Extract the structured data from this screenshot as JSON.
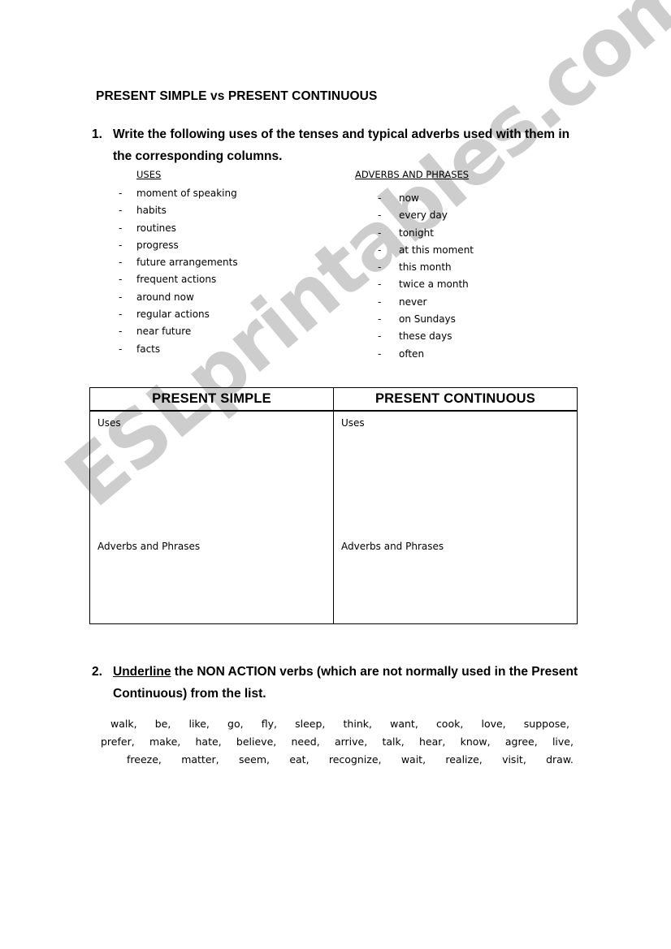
{
  "document": {
    "title": "PRESENT SIMPLE vs PRESENT CONTINUOUS"
  },
  "questions": [
    {
      "number": "1.",
      "text_part1": "Write the following uses of the tenses and typical adverbs used with them in the corresponding columns."
    },
    {
      "number": "2.",
      "underlined": "Underline",
      "text_rest": " the NON ACTION verbs (which are not normally used in the Present Continuous) from the list."
    }
  ],
  "uses_column": {
    "heading": "USES",
    "dash": "-",
    "items": [
      "moment of speaking",
      "habits",
      "routines",
      "progress",
      "future arrangements",
      "frequent actions",
      "around now",
      "regular actions",
      "near future",
      "facts"
    ]
  },
  "adverbs_column": {
    "heading": "ADVERBS AND PHRASES",
    "dash": "-",
    "items": [
      "now",
      "every day",
      "tonight",
      "at this moment",
      "this month",
      "twice a month",
      "never",
      "on Sundays",
      "these days",
      "often"
    ]
  },
  "tense_table": {
    "headers": [
      "PRESENT SIMPLE",
      "PRESENT CONTINUOUS"
    ],
    "row_labels": [
      "Uses",
      "Adverbs and Phrases"
    ],
    "cells": [
      {
        "uses": "Uses",
        "adverbs": "Adverbs and Phrases"
      },
      {
        "uses": "Uses",
        "adverbs": "Adverbs and Phrases"
      }
    ]
  },
  "verb_list": {
    "lines": [
      [
        "walk,",
        "be,",
        "like,",
        "go,",
        "fly,",
        "sleep,",
        "think,",
        "want,",
        "cook,",
        "love,",
        "suppose,"
      ],
      [
        "prefer,",
        "make,",
        "hate,",
        "believe,",
        "need,",
        "arrive,",
        "talk,",
        "hear,",
        "know,",
        "agree,",
        "live,"
      ],
      [
        "freeze,",
        "matter,",
        "seem,",
        "eat,",
        "recognize,",
        "wait,",
        "realize,",
        "visit,",
        "draw."
      ]
    ]
  },
  "watermark": {
    "text": "ESLprintables.com",
    "color": "#cdcdcd"
  }
}
